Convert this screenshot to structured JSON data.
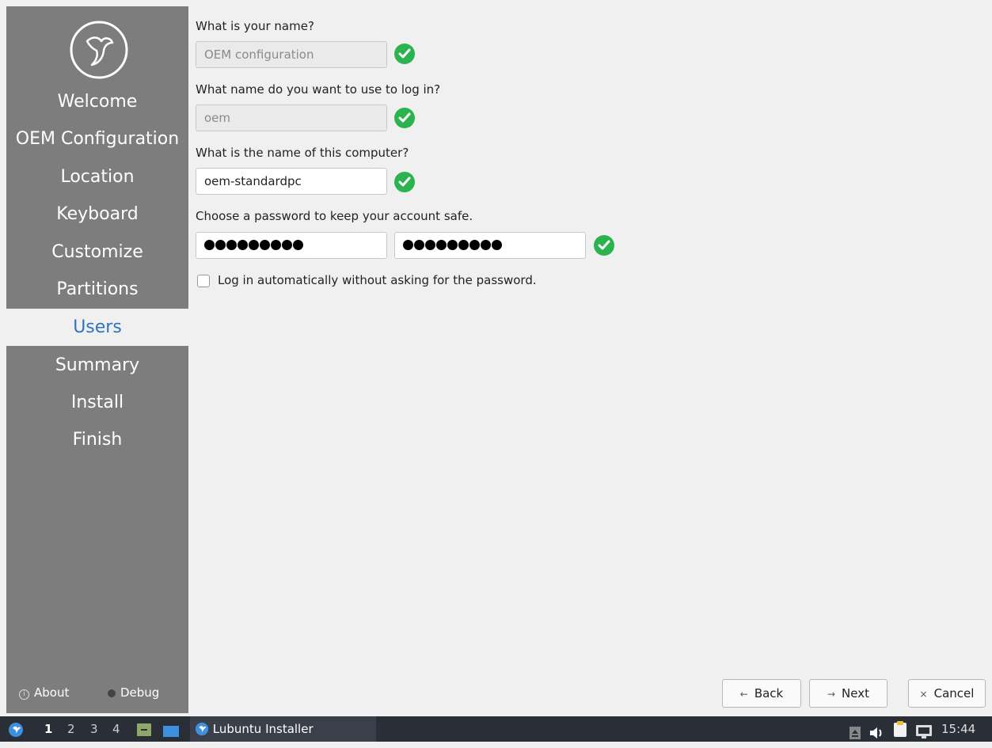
{
  "sidebar": {
    "items": [
      {
        "label": "Welcome"
      },
      {
        "label": "OEM Configuration"
      },
      {
        "label": "Location"
      },
      {
        "label": "Keyboard"
      },
      {
        "label": "Customize"
      },
      {
        "label": "Partitions"
      },
      {
        "label": "Users",
        "active": true
      },
      {
        "label": "Summary"
      },
      {
        "label": "Install"
      },
      {
        "label": "Finish"
      }
    ],
    "about_label": "About",
    "debug_label": "Debug"
  },
  "form": {
    "name_question": "What is your name?",
    "name_value": "OEM configuration",
    "login_question": "What name do you want to use to log in?",
    "login_value": "oem",
    "computer_question": "What is the name of this computer?",
    "computer_value": "oem-standardpc",
    "password_question": "Choose a password to keep your account safe.",
    "password_mask_count": 9,
    "autologin_label": "Log in automatically without asking for the password.",
    "autologin_checked": false
  },
  "buttons": {
    "back_label": "Back",
    "next_label": "Next",
    "cancel_label": "Cancel"
  },
  "taskbar": {
    "workspaces": [
      "1",
      "2",
      "3",
      "4"
    ],
    "active_workspace": "1",
    "task_label": "Lubuntu Installer",
    "clock": "15:44"
  },
  "colors": {
    "accent": "#2f74c0",
    "sidebar": "#7d7d7d",
    "valid_check": "#2bb34f",
    "taskbar": "#2a2e36"
  }
}
